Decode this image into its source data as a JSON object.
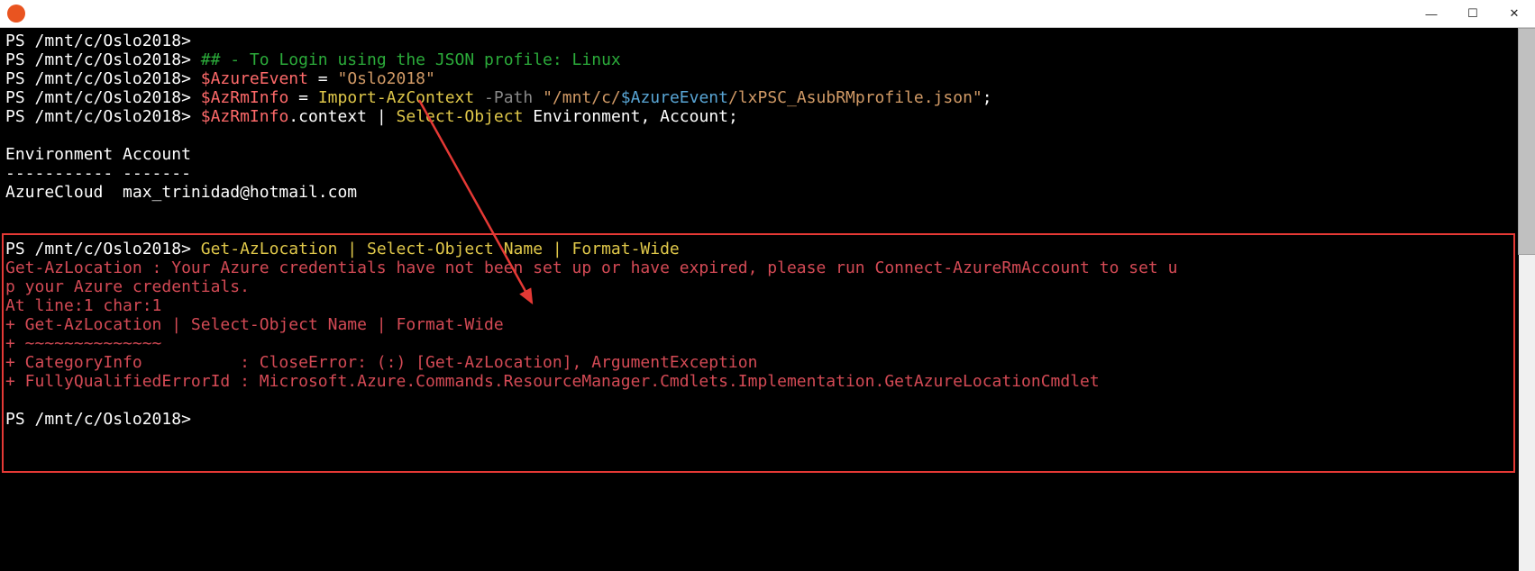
{
  "prompt": "PS /mnt/c/Oslo2018>",
  "lines": {
    "l2_comment": "## - To Login using the JSON profile: Linux",
    "l3_var": "$AzureEvent",
    "l3_eq": " = ",
    "l3_val": "\"Oslo2018\"",
    "l4_var": "$AzRmInfo",
    "l4_eq": " = ",
    "l4_cmd": "Import-AzContext",
    "l4_param": " -Path ",
    "l4_path_q1": "\"/mnt/c/",
    "l4_path_var": "$AzureEvent",
    "l4_path_q2": "/lxPSC_AsubRMprofile.json\"",
    "l4_semi": ";",
    "l5_var": "$AzRmInfo",
    "l5_dot": ".context ",
    "l5_pipe": "|",
    "l5_sel": " Select-Object ",
    "l5_args": "Environment, Account;",
    "hdr": "Environment Account",
    "div": "----------- -------",
    "row": "AzureCloud  max_trinidad@hotmail.com",
    "cmd2": "Get-AzLocation | Select-Object Name | Format-Wide",
    "err1": "Get-AzLocation : Your Azure credentials have not been set up or have expired, please run Connect-AzureRmAccount to set u",
    "err2": "p your Azure credentials.",
    "err3": "At line:1 char:1",
    "err4": "+ Get-AzLocation | Select-Object Name | Format-Wide",
    "err5": "+ ~~~~~~~~~~~~~~",
    "err6": "+ CategoryInfo          : CloseError: (:) [Get-AzLocation], ArgumentException",
    "err7": "+ FullyQualifiedErrorId : Microsoft.Azure.Commands.ResourceManager.Cmdlets.Implementation.GetAzureLocationCmdlet"
  },
  "window_buttons": {
    "minimize": "—",
    "maximize": "☐",
    "close": "✕"
  }
}
